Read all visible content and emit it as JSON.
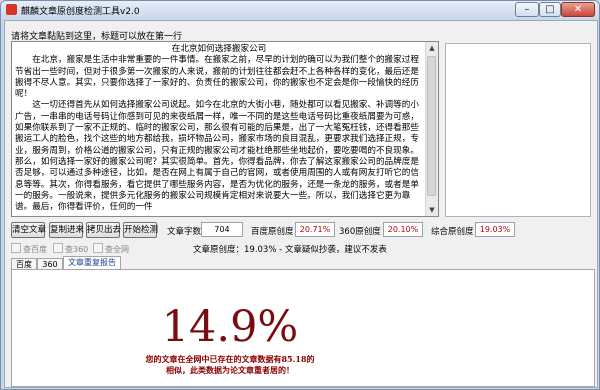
{
  "window": {
    "title": "麒麟文章原创度检测工具v2.0",
    "minimize_glyph": "–",
    "maximize_glyph": "□",
    "close_glyph": "✕"
  },
  "input": {
    "prompt": "请将文章黏贴到这里，标题可以放在第一行",
    "article_title": "在北京如何选择搬家公司",
    "paragraphs": [
      "在北京，搬家是生活中非常重要的一件事情。在搬家之前，尽早的计划的确可以为我们整个的搬家过程节省出一些时间，但对于很多第一次搬家的人来说，搬前的计划往往都会赶不上各种各样的变化，最后还是搬得不尽人意。其实，只要你选择了一家好的、负责任的搬家公司，你的搬家也不定会是你一段愉快的经历呢！",
      "这一切还得首先从如何选择搬家公司说起。如今在北京的大街小巷，随处都可以看见搬家、补调等的小广告，一串串的电话号码让你感到可见的来夜纸屑一样，唯一不同的是这些电话号码比重夜纸屑要为可惑，如果你联系到了一家不正规的、临时的搬家公司，那么很有可能的后果是，出了一大笔冤枉钱，还得看那些搬运工人的脸色，找个这些的地方都给我，损坏物品公司，搬家市场的良目混乱，更要求我们选择正规，专业，服务周到，价格公道的搬家公司，只有正规的搬家公司才能杜绝那些坐地起价，要吃要喝的不良现象。那么，如何选择一家好的搬家公司呢？其实很简单。首先，你得看品牌，你去了解这家搬家公司的品牌度是否足够，可以通过多种途径，比如，是否在网上有属于自己的官网，或者使用周围的人或有网友打听它的信息等等。其次，你得看服务，看它提供了哪些服务内容，是否为优化的服务，还是一条龙的服务，或者是单一的服务。一般说来，提供多元化服务的搬家公司规模肯定相对来说要大一些。所以，我们选择它更为靠谱。最后，你得看评价，任何的一件"
    ]
  },
  "toolbar": {
    "clear_text": "清空文章",
    "copy_in": "复制进来",
    "copy_out": "拷贝出去",
    "start_detect": "开始检测",
    "word_count_label": "文章字数",
    "word_count": "704",
    "baidu_label": "百度原创度",
    "baidu_value": "20.71%",
    "s360_label": "360原创度",
    "s360_value": "20.10%",
    "overall_label": "综合原创度",
    "overall_value": "19.03%"
  },
  "options": [
    {
      "label": "查百度"
    },
    {
      "label": "查360"
    },
    {
      "label": "查全网"
    }
  ],
  "status_message": "文章原创度：19.03% - 文章疑似抄袭，建议不发表",
  "tabs": [
    {
      "label": "百度"
    },
    {
      "label": "360"
    },
    {
      "label": "文章重复报告"
    }
  ],
  "report": {
    "percentage": "14.9%",
    "result_lines": [
      "您的文章在全网中已存在的文章数据有85.18的",
      "相似，此类数据为论文章重者居的！"
    ]
  },
  "colors": {
    "report_red": "#7a0b10",
    "value_red": "#c00000"
  }
}
